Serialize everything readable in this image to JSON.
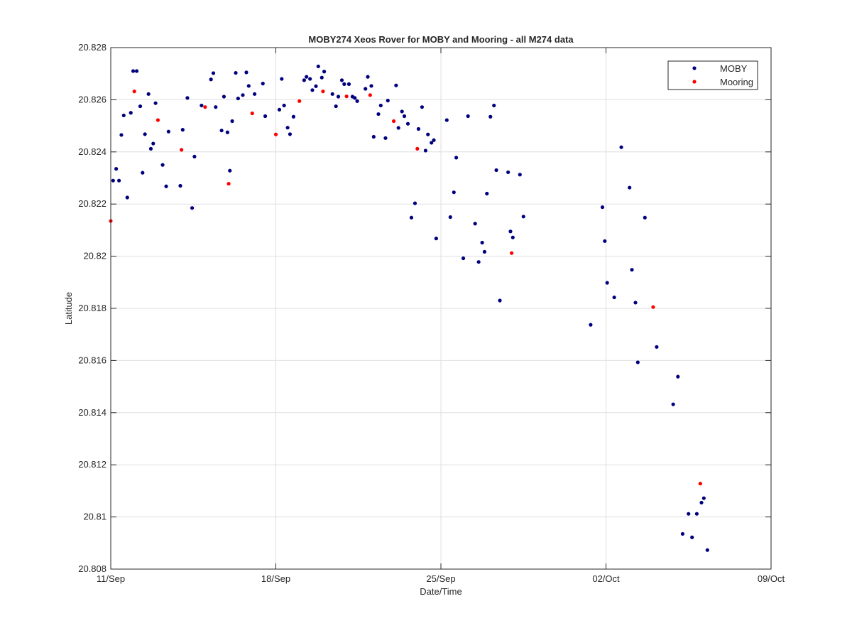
{
  "chart_data": {
    "type": "scatter",
    "title": "MOBY274 Xeos Rover for MOBY and Mooring - all M274 data",
    "xlabel": "Date/Time",
    "ylabel": "Latitude",
    "x_unit": "days in Sep",
    "xlim": [
      11,
      39
    ],
    "ylim": [
      20.808,
      20.828
    ],
    "xticks": [
      {
        "value": 11,
        "label": "11/Sep"
      },
      {
        "value": 18,
        "label": "18/Sep"
      },
      {
        "value": 25,
        "label": "25/Sep"
      },
      {
        "value": 32,
        "label": "02/Oct"
      },
      {
        "value": 39,
        "label": "09/Oct"
      }
    ],
    "yticks": [
      {
        "value": 20.808,
        "label": "20.808"
      },
      {
        "value": 20.81,
        "label": "20.81"
      },
      {
        "value": 20.812,
        "label": "20.812"
      },
      {
        "value": 20.814,
        "label": "20.814"
      },
      {
        "value": 20.816,
        "label": "20.816"
      },
      {
        "value": 20.818,
        "label": "20.818"
      },
      {
        "value": 20.82,
        "label": "20.82"
      },
      {
        "value": 20.822,
        "label": "20.822"
      },
      {
        "value": 20.824,
        "label": "20.824"
      },
      {
        "value": 20.826,
        "label": "20.826"
      },
      {
        "value": 20.828,
        "label": "20.828"
      }
    ],
    "grid": true,
    "legend_position": "top-right",
    "series": [
      {
        "name": "MOBY",
        "color": "#00007f",
        "points": [
          [
            11.1,
            20.8229
          ],
          [
            11.23,
            20.82335
          ],
          [
            11.35,
            20.8229
          ],
          [
            11.45,
            20.82465
          ],
          [
            11.55,
            20.8254
          ],
          [
            11.7,
            20.82225
          ],
          [
            11.85,
            20.8255
          ],
          [
            11.95,
            20.8271
          ],
          [
            12.1,
            20.8271
          ],
          [
            12.25,
            20.82575
          ],
          [
            12.35,
            20.8232
          ],
          [
            12.45,
            20.82468
          ],
          [
            12.6,
            20.82622
          ],
          [
            12.7,
            20.82412
          ],
          [
            12.8,
            20.82432
          ],
          [
            12.9,
            20.82587
          ],
          [
            13.2,
            20.8235
          ],
          [
            13.35,
            20.82268
          ],
          [
            13.45,
            20.82478
          ],
          [
            13.95,
            20.8227
          ],
          [
            14.05,
            20.82485
          ],
          [
            14.25,
            20.82607
          ],
          [
            14.45,
            20.82185
          ],
          [
            14.55,
            20.82382
          ],
          [
            14.85,
            20.82578
          ],
          [
            15.25,
            20.82678
          ],
          [
            15.35,
            20.82702
          ],
          [
            15.45,
            20.82572
          ],
          [
            15.7,
            20.82482
          ],
          [
            15.8,
            20.82612
          ],
          [
            15.95,
            20.82475
          ],
          [
            16.05,
            20.82328
          ],
          [
            16.15,
            20.82518
          ],
          [
            16.3,
            20.82703
          ],
          [
            16.4,
            20.82605
          ],
          [
            16.6,
            20.82618
          ],
          [
            16.75,
            20.82705
          ],
          [
            16.85,
            20.82653
          ],
          [
            17.1,
            20.82622
          ],
          [
            17.45,
            20.82662
          ],
          [
            17.55,
            20.82537
          ],
          [
            18.15,
            20.82562
          ],
          [
            18.25,
            20.8268
          ],
          [
            18.35,
            20.82578
          ],
          [
            18.5,
            20.82493
          ],
          [
            18.6,
            20.82468
          ],
          [
            18.75,
            20.82535
          ],
          [
            19.2,
            20.82675
          ],
          [
            19.3,
            20.82688
          ],
          [
            19.45,
            20.8268
          ],
          [
            19.55,
            20.82637
          ],
          [
            19.7,
            20.82652
          ],
          [
            19.8,
            20.82728
          ],
          [
            19.95,
            20.82685
          ],
          [
            20.05,
            20.82708
          ],
          [
            20.4,
            20.82622
          ],
          [
            20.55,
            20.82575
          ],
          [
            20.65,
            20.82612
          ],
          [
            20.8,
            20.82675
          ],
          [
            20.9,
            20.8266
          ],
          [
            21.1,
            20.8266
          ],
          [
            21.25,
            20.82612
          ],
          [
            21.35,
            20.82607
          ],
          [
            21.45,
            20.82595
          ],
          [
            21.8,
            20.82642
          ],
          [
            21.9,
            20.82688
          ],
          [
            22.05,
            20.82653
          ],
          [
            22.15,
            20.82458
          ],
          [
            22.35,
            20.82545
          ],
          [
            22.45,
            20.82578
          ],
          [
            22.65,
            20.82453
          ],
          [
            22.75,
            20.82597
          ],
          [
            23.1,
            20.82655
          ],
          [
            23.2,
            20.82492
          ],
          [
            23.35,
            20.82555
          ],
          [
            23.45,
            20.82537
          ],
          [
            23.6,
            20.82508
          ],
          [
            23.75,
            20.82148
          ],
          [
            23.9,
            20.82203
          ],
          [
            24.05,
            20.82488
          ],
          [
            24.2,
            20.82572
          ],
          [
            24.35,
            20.82405
          ],
          [
            24.45,
            20.82467
          ],
          [
            24.6,
            20.82435
          ],
          [
            24.7,
            20.82445
          ],
          [
            24.8,
            20.82068
          ],
          [
            25.25,
            20.82522
          ],
          [
            25.4,
            20.8215
          ],
          [
            25.55,
            20.82245
          ],
          [
            25.65,
            20.82378
          ],
          [
            25.95,
            20.81992
          ],
          [
            26.15,
            20.82537
          ],
          [
            26.45,
            20.82125
          ],
          [
            26.6,
            20.81978
          ],
          [
            26.75,
            20.82052
          ],
          [
            26.85,
            20.82017
          ],
          [
            26.95,
            20.8224
          ],
          [
            27.1,
            20.82535
          ],
          [
            27.25,
            20.82578
          ],
          [
            27.35,
            20.8233
          ],
          [
            27.5,
            20.8183
          ],
          [
            27.85,
            20.82322
          ],
          [
            27.95,
            20.82095
          ],
          [
            28.05,
            20.82072
          ],
          [
            28.35,
            20.82313
          ],
          [
            28.5,
            20.82152
          ],
          [
            31.35,
            20.81737
          ],
          [
            31.85,
            20.82188
          ],
          [
            31.95,
            20.82058
          ],
          [
            32.05,
            20.81898
          ],
          [
            32.35,
            20.81842
          ],
          [
            32.65,
            20.82418
          ],
          [
            33.0,
            20.82263
          ],
          [
            33.1,
            20.81948
          ],
          [
            33.25,
            20.81822
          ],
          [
            33.35,
            20.81593
          ],
          [
            33.65,
            20.82148
          ],
          [
            34.15,
            20.81652
          ],
          [
            34.85,
            20.81432
          ],
          [
            35.05,
            20.81538
          ],
          [
            35.25,
            20.80935
          ],
          [
            35.5,
            20.81012
          ],
          [
            35.65,
            20.80922
          ],
          [
            35.85,
            20.81012
          ],
          [
            36.05,
            20.81055
          ],
          [
            36.15,
            20.81072
          ],
          [
            36.3,
            20.80873
          ]
        ]
      },
      {
        "name": "Mooring",
        "color": "#ff0000",
        "points": [
          [
            11.0,
            20.82135
          ],
          [
            12.0,
            20.82632
          ],
          [
            13.0,
            20.82522
          ],
          [
            14.0,
            20.82408
          ],
          [
            15.0,
            20.82572
          ],
          [
            16.0,
            20.82278
          ],
          [
            17.0,
            20.82548
          ],
          [
            18.0,
            20.82467
          ],
          [
            19.0,
            20.82595
          ],
          [
            20.0,
            20.82632
          ],
          [
            21.0,
            20.82613
          ],
          [
            22.0,
            20.82618
          ],
          [
            23.0,
            20.82518
          ],
          [
            24.0,
            20.82412
          ],
          [
            28.0,
            20.82012
          ],
          [
            34.0,
            20.81805
          ],
          [
            36.0,
            20.81128
          ]
        ]
      }
    ]
  }
}
